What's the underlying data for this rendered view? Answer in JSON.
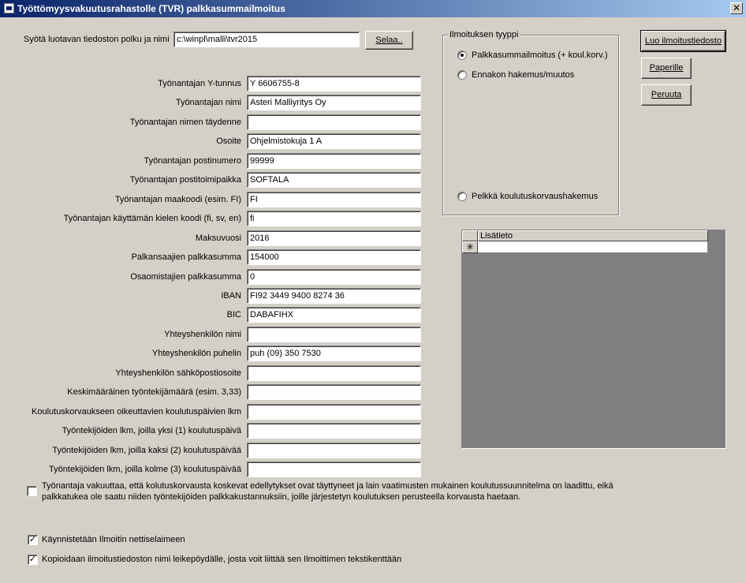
{
  "window": {
    "title": "Työttömyysvakuutusrahastolle (TVR) palkkasummailmoitus",
    "close_glyph": "✕"
  },
  "file": {
    "label": "Syötä luotavan tiedoston polku ja nimi",
    "path": "c:\\winpl\\malli\\tvr2015",
    "browse_label": "Selaa.."
  },
  "form": {
    "fields": [
      {
        "label": "Työnantajan Y-tunnus",
        "value": "Y 6606755-8"
      },
      {
        "label": "Työnantajan nimi",
        "value": "Asteri Malliyritys Oy"
      },
      {
        "label": "Työnantajan nimen täydenne",
        "value": ""
      },
      {
        "label": "Osoite",
        "value": "Ohjelmistokuja 1 A"
      },
      {
        "label": "Työnantajan postinumero",
        "value": "99999"
      },
      {
        "label": "Työnantajan postitoimipaikka",
        "value": "SOFTALA"
      },
      {
        "label": "Työnantajan maakoodi (esim. FI)",
        "value": "FI"
      },
      {
        "label": "Työnantajan käyttämän kielen koodi (fi, sv, en)",
        "value": "fi"
      },
      {
        "label": "Maksuvuosi",
        "value": "2016"
      },
      {
        "label": "Palkansaajien palkkasumma",
        "value": "154000"
      },
      {
        "label": "Osaomistajien palkkasumma",
        "value": "0"
      },
      {
        "label": "IBAN",
        "value": "FI92 3449 9400 8274 36"
      },
      {
        "label": "BIC",
        "value": "DABAFIHX"
      },
      {
        "label": "Yhteyshenkilön nimi",
        "value": ""
      },
      {
        "label": "Yhteyshenkilön puhelin",
        "value": "puh (09) 350 7530"
      },
      {
        "label": "Yhteyshenkilön sähköpostiosoite",
        "value": ""
      },
      {
        "label": "Keskimääräinen työntekijämäärä (esim. 3,33)",
        "value": ""
      },
      {
        "label": "Koulutuskorvaukseen oikeuttavien koulutuspäivien lkm",
        "value": ""
      },
      {
        "label": "Työntekijöiden lkm, joilla yksi (1) koulutuspäivä",
        "value": ""
      },
      {
        "label": "Työntekijöiden lkm, joilla kaksi (2) koulutuspäivää",
        "value": ""
      },
      {
        "label": "Työntekijöiden lkm, joilla kolme (3) koulutuspäivää",
        "value": ""
      }
    ]
  },
  "notice_type": {
    "title": "Ilmoituksen tyyppi",
    "options": [
      {
        "label": "Palkkasummailmoitus (+ koul.korv.)",
        "selected": true
      },
      {
        "label": "Ennakon hakemus/muutos",
        "selected": false
      },
      {
        "label": "Pelkkä koulutuskorvaushakemus",
        "selected": false
      }
    ]
  },
  "buttons": {
    "create": "Luo ilmoitustiedosto",
    "paper": "Paperille",
    "cancel": "Peruuta"
  },
  "grid": {
    "column": "Lisätieto",
    "new_row_marker": "✳"
  },
  "checkboxes": {
    "assurance": {
      "text": "Työnantaja vakuuttaa, että kolutuskorvausta koskevat edellytykset ovat täyttyneet ja lain vaatimusten mukainen koulutussuunnitelma on laadittu, eikä palkkatukea ole saatu niiden työntekijöiden palkkakustannuksiin, joille järjestetyn koulutuksen perusteella korvausta haetaan.",
      "checked": false
    },
    "launch_browser": {
      "text": "Käynnistetään Ilmoitin nettiselaimeen",
      "checked": true,
      "mark": "✓"
    },
    "copy_clipboard": {
      "text": "Kopioidaan ilmoitustiedoston nimi leikepöydälle, josta voit liittää sen Ilmoittimen tekstikenttään",
      "checked": true,
      "mark": "✓"
    }
  }
}
